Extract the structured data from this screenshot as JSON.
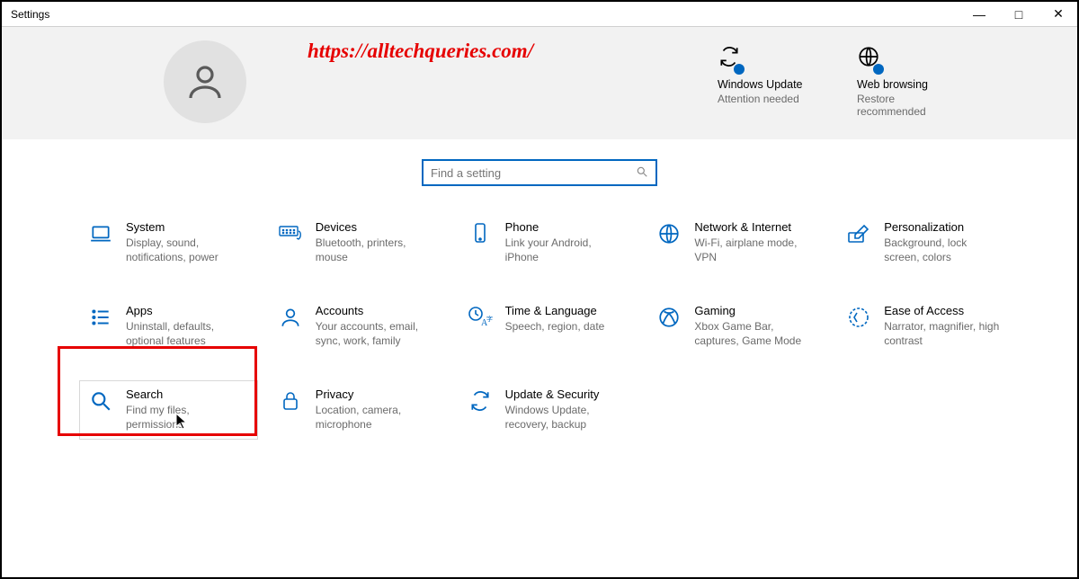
{
  "window": {
    "title": "Settings"
  },
  "watermark": "https://alltechqueries.com/",
  "status": {
    "update": {
      "title": "Windows Update",
      "sub": "Attention needed"
    },
    "web": {
      "title": "Web browsing",
      "sub": "Restore recommended"
    }
  },
  "search": {
    "placeholder": "Find a setting"
  },
  "categories": [
    {
      "key": "system",
      "title": "System",
      "sub": "Display, sound, notifications, power"
    },
    {
      "key": "devices",
      "title": "Devices",
      "sub": "Bluetooth, printers, mouse"
    },
    {
      "key": "phone",
      "title": "Phone",
      "sub": "Link your Android, iPhone"
    },
    {
      "key": "network",
      "title": "Network & Internet",
      "sub": "Wi-Fi, airplane mode, VPN"
    },
    {
      "key": "personalization",
      "title": "Personalization",
      "sub": "Background, lock screen, colors"
    },
    {
      "key": "apps",
      "title": "Apps",
      "sub": "Uninstall, defaults, optional features"
    },
    {
      "key": "accounts",
      "title": "Accounts",
      "sub": "Your accounts, email, sync, work, family"
    },
    {
      "key": "time",
      "title": "Time & Language",
      "sub": "Speech, region, date"
    },
    {
      "key": "gaming",
      "title": "Gaming",
      "sub": "Xbox Game Bar, captures, Game Mode"
    },
    {
      "key": "ease",
      "title": "Ease of Access",
      "sub": "Narrator, magnifier, high contrast"
    },
    {
      "key": "search",
      "title": "Search",
      "sub": "Find my files, permissions"
    },
    {
      "key": "privacy",
      "title": "Privacy",
      "sub": "Location, camera, microphone"
    },
    {
      "key": "update",
      "title": "Update & Security",
      "sub": "Windows Update, recovery, backup"
    }
  ],
  "icons": {
    "system": "laptop-icon",
    "devices": "keyboard-icon",
    "phone": "phone-icon",
    "network": "globe-icon",
    "personalization": "pen-icon",
    "apps": "list-icon",
    "accounts": "person-icon",
    "time": "clock-letter-icon",
    "gaming": "xbox-icon",
    "ease": "ease-icon",
    "search": "search-icon",
    "privacy": "lock-icon",
    "update": "sync-icon"
  },
  "colors": {
    "accent": "#0067c0",
    "watermark": "#e60000",
    "muted": "#6b6b6b"
  }
}
